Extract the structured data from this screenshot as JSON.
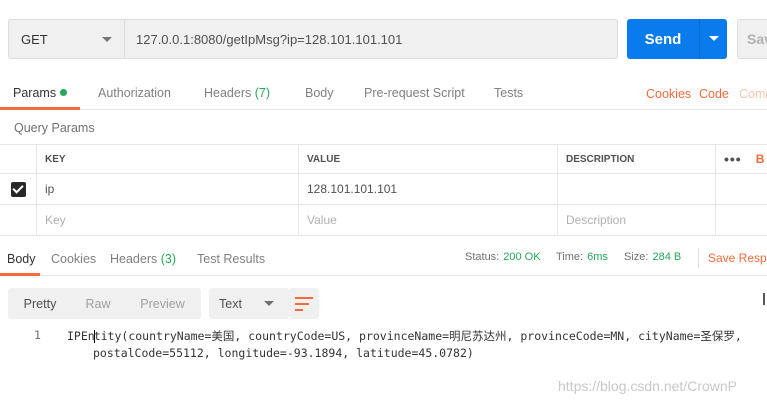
{
  "request": {
    "method": "GET",
    "url": "127.0.0.1:8080/getIpMsg?ip=128.101.101.101",
    "send_label": "Send",
    "save_label": "Sav"
  },
  "request_tabs": {
    "params": "Params",
    "authorization": "Authorization",
    "headers": "Headers",
    "headers_count": "(7)",
    "body": "Body",
    "pre_request": "Pre-request Script",
    "tests": "Tests",
    "cookies": "Cookies",
    "code": "Code",
    "comments": "Comm"
  },
  "query_params": {
    "title": "Query Params",
    "columns": {
      "key": "KEY",
      "value": "VALUE",
      "description": "DESCRIPTION"
    },
    "more": "•••",
    "bulk": "B",
    "rows": [
      {
        "key": "ip",
        "value": "128.101.101.101",
        "description": "",
        "checked": true
      }
    ],
    "placeholder": {
      "key": "Key",
      "value": "Value",
      "description": "Description"
    }
  },
  "response_tabs": {
    "body": "Body",
    "cookies": "Cookies",
    "headers": "Headers",
    "headers_count": "(3)",
    "test_results": "Test Results"
  },
  "response_status": {
    "status_label": "Status:",
    "status_value": "200 OK",
    "time_label": "Time:",
    "time_value": "6ms",
    "size_label": "Size:",
    "size_value": "284 B",
    "save_response": "Save Resp"
  },
  "body_toolbar": {
    "pretty": "Pretty",
    "raw": "Raw",
    "preview": "Preview",
    "format": "Text"
  },
  "response_body": {
    "line_number": "1",
    "line1_a": "IPEn",
    "line1_b": "tity(countryName=美国, countryCode=US, provinceName=明尼苏达州, provinceCode=MN, cityName=圣保罗,",
    "line2": "postalCode=55112, longitude=-93.1894, latitude=45.0782)"
  },
  "watermark": "https://blog.csdn.net/CrownP",
  "colors": {
    "accent": "#f26b3a",
    "send_blue": "#097bed",
    "success_green": "#26a65b"
  }
}
